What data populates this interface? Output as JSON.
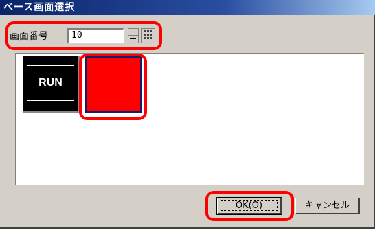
{
  "window": {
    "title": "ベース画面選択"
  },
  "screen_number": {
    "label": "画面番号",
    "value": "10"
  },
  "thumbnails": [
    {
      "name": "run",
      "label": "RUN",
      "color": "#000000"
    },
    {
      "name": "red",
      "label": "",
      "color": "#ff0000"
    }
  ],
  "buttons": {
    "ok_label": "OK(O)",
    "cancel_label": "キャンセル"
  },
  "callout_color": "#ff0000",
  "icons": {
    "spin": "spin-icon",
    "keypad": "keypad-icon"
  }
}
